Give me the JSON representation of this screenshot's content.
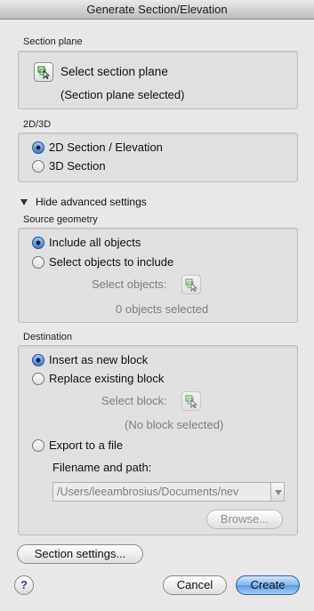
{
  "window": {
    "title": "Generate Section/Elevation"
  },
  "section_plane": {
    "group_label": "Section plane",
    "select_label": "Select section plane",
    "status": "(Section plane selected)"
  },
  "mode": {
    "group_label": "2D/3D",
    "options": [
      {
        "label": "2D Section / Elevation",
        "selected": true
      },
      {
        "label": "3D Section",
        "selected": false
      }
    ]
  },
  "advanced": {
    "toggle_label": "Hide advanced settings"
  },
  "source_geometry": {
    "group_label": "Source geometry",
    "options": [
      {
        "label": "Include all objects",
        "selected": true
      },
      {
        "label": "Select objects to include",
        "selected": false
      }
    ],
    "select_objects_label": "Select objects:",
    "count_text": "0 objects selected"
  },
  "destination": {
    "group_label": "Destination",
    "options": [
      {
        "label": "Insert as new block",
        "selected": true
      },
      {
        "label": "Replace existing block",
        "selected": false
      },
      {
        "label": "Export to a file",
        "selected": false
      }
    ],
    "select_block_label": "Select block:",
    "block_status": "(No block selected)",
    "filename_label": "Filename and path:",
    "path_value": "/Users/leeambrosius/Documents/nev",
    "browse_label": "Browse..."
  },
  "footer": {
    "section_settings_label": "Section settings...",
    "help_glyph": "?",
    "cancel_label": "Cancel",
    "create_label": "Create"
  },
  "colors": {
    "primary_button": "#5e9ce6",
    "radio_selected": "#3a7fd5"
  },
  "icons": {
    "pick": "select-pick-icon",
    "help": "help-icon"
  }
}
